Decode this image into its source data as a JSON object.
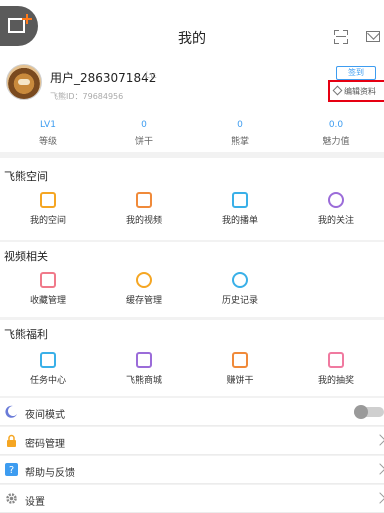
{
  "header": {
    "title": "我的"
  },
  "profile": {
    "username": "用户_2863071842",
    "level_badge": "Lv.",
    "user_id": "飞熊ID：79684956",
    "checkin_label": "签到",
    "edit_label": "编辑资料"
  },
  "stats": [
    {
      "value": "LV1",
      "label": "等级"
    },
    {
      "value": "0",
      "label": "饼干"
    },
    {
      "value": "0",
      "label": "熊掌"
    },
    {
      "value": "0.0",
      "label": "魅力值"
    }
  ],
  "sections": [
    {
      "title": "飞熊空间",
      "items": [
        {
          "label": "我的空间",
          "icon": "home-icon",
          "color": "#f5a623"
        },
        {
          "label": "我的视频",
          "icon": "video-icon",
          "color": "#f08a3a"
        },
        {
          "label": "我的播单",
          "icon": "playlist-icon",
          "color": "#3ab0e8"
        },
        {
          "label": "我的关注",
          "icon": "follow-icon",
          "color": "#9b6cd9"
        }
      ]
    },
    {
      "title": "视频相关",
      "items": [
        {
          "label": "收藏管理",
          "icon": "favorite-icon",
          "color": "#f07a8a"
        },
        {
          "label": "缓存管理",
          "icon": "cache-icon",
          "color": "#f5a623"
        },
        {
          "label": "历史记录",
          "icon": "history-icon",
          "color": "#3ab0e8"
        }
      ]
    },
    {
      "title": "飞熊福利",
      "items": [
        {
          "label": "任务中心",
          "icon": "task-icon",
          "color": "#3ab0e8"
        },
        {
          "label": "飞熊商城",
          "icon": "cart-icon",
          "color": "#9b6cd9"
        },
        {
          "label": "赚饼干",
          "icon": "earn-icon",
          "color": "#f08a3a"
        },
        {
          "label": "我的抽奖",
          "icon": "lottery-icon",
          "color": "#f07aa0"
        }
      ]
    }
  ],
  "settings_rows": [
    {
      "label": "夜间模式",
      "icon": "moon-icon",
      "color": "#6a7bd8",
      "control": "toggle",
      "toggle_on": false
    },
    {
      "label": "密码管理",
      "icon": "lock-icon",
      "color": "#f5a623",
      "control": "chevron"
    },
    {
      "label": "帮助与反馈",
      "icon": "help-icon",
      "color": "#3d9cf0",
      "control": "chevron"
    },
    {
      "label": "设置",
      "icon": "gear-icon",
      "color": "#888888",
      "control": "chevron"
    }
  ]
}
